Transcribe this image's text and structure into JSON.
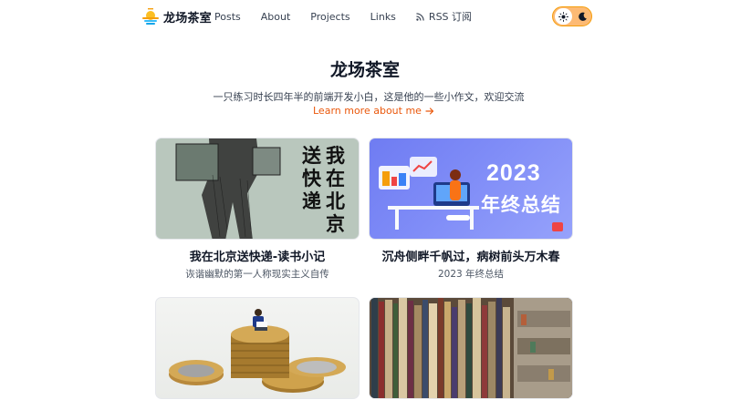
{
  "site": {
    "name": "龙场茶室"
  },
  "nav": {
    "items": [
      {
        "label": "Posts"
      },
      {
        "label": "About"
      },
      {
        "label": "Projects"
      },
      {
        "label": "Links"
      }
    ],
    "rss_label": "RSS 订阅"
  },
  "theme_toggle": {
    "mode": "light",
    "icons": [
      "sun-icon",
      "moon-icon"
    ]
  },
  "hero": {
    "title": "龙场茶室",
    "subtitle": "一只练习时长四年半的前端开发小白，这是他的一些小作文，欢迎交流",
    "learn_more": "Learn more about me"
  },
  "posts": [
    {
      "title": "我在北京送快递-读书小记",
      "subtitle": "诙谐幽默的第一人称现实主义自传",
      "cover_text": [
        "我在北京",
        "送快递"
      ]
    },
    {
      "title": "沉舟侧畔千帆过，病树前头万木春",
      "subtitle": "2023 年终总结",
      "cover_text": [
        "2023",
        "年终总结"
      ]
    },
    {
      "title": "",
      "subtitle": ""
    },
    {
      "title": "",
      "subtitle": ""
    }
  ],
  "colors": {
    "accent": "#ea580c",
    "toggle_bg": "#fdba74",
    "card2_bg": "#7f8cf7",
    "card1_bg": "#b9c7bd"
  }
}
